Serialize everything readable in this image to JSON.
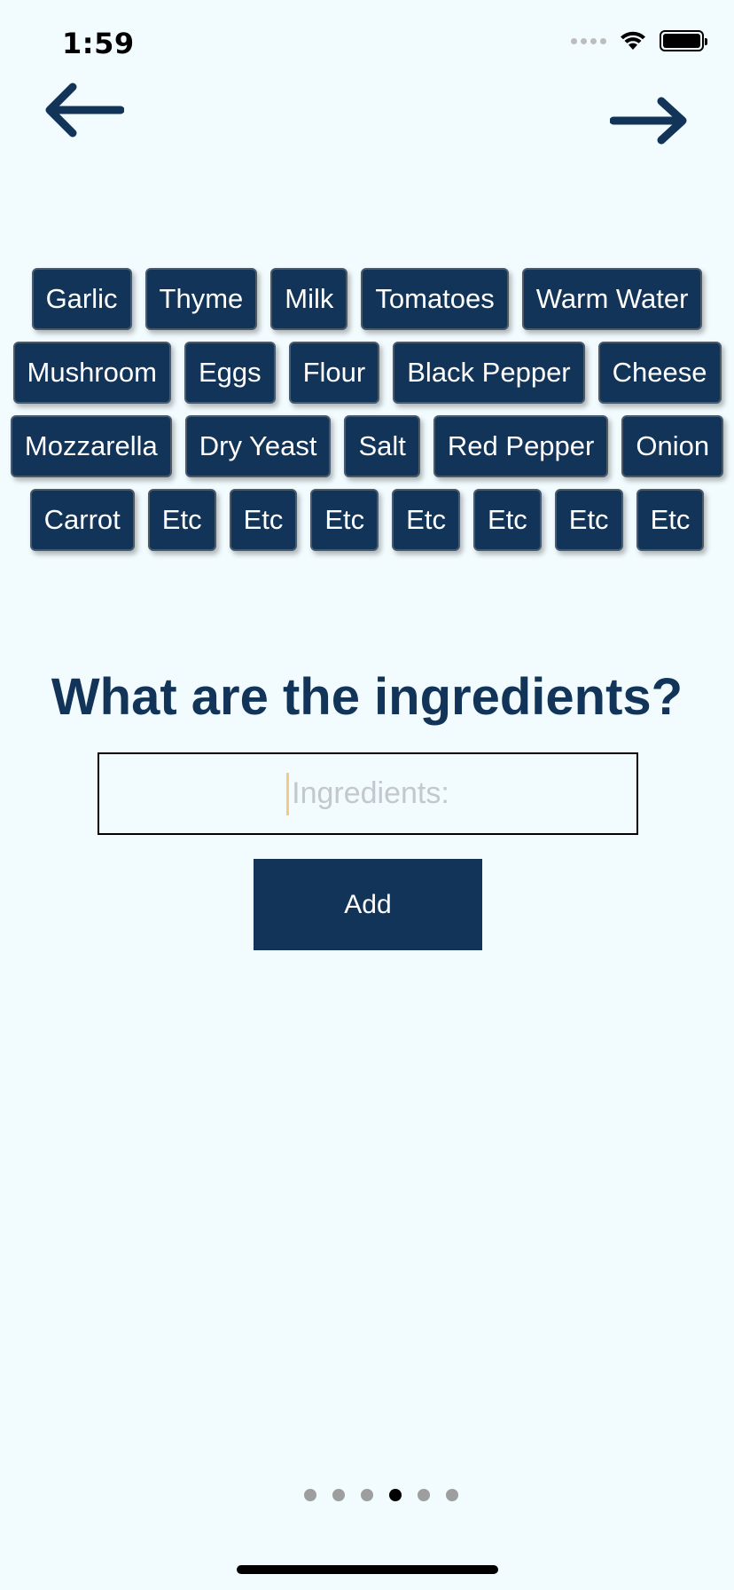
{
  "status_bar": {
    "time": "1:59"
  },
  "nav": {
    "back_icon": "arrow-left-icon",
    "forward_icon": "arrow-right-icon"
  },
  "ingredient_chips": [
    [
      "Garlic",
      "Thyme",
      "Milk",
      "Tomatoes",
      "Warm Water"
    ],
    [
      "Mushroom",
      "Eggs",
      "Flour",
      "Black Pepper",
      "Cheese"
    ],
    [
      "Mozzarella",
      "Dry Yeast",
      "Salt",
      "Red Pepper",
      "Onion"
    ],
    [
      "Carrot",
      "Etc",
      "Etc",
      "Etc",
      "Etc",
      "Etc",
      "Etc",
      "Etc"
    ]
  ],
  "main": {
    "question": "What are the ingredients?",
    "input_placeholder": "Ingredients:",
    "input_value": "",
    "add_label": "Add"
  },
  "pagination": {
    "total": 6,
    "active_index": 3
  },
  "colors": {
    "background": "#F2FBFE",
    "primary": "#113458",
    "caret": "#F5C88A"
  }
}
